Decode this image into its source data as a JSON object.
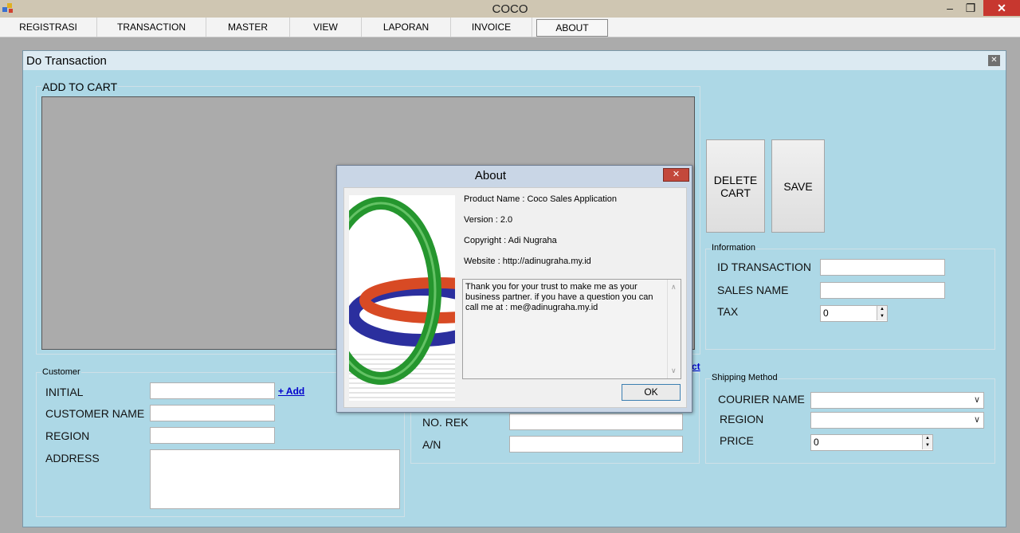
{
  "window": {
    "title": "COCO",
    "minimize": "–",
    "restore": "❐",
    "close": "✕"
  },
  "menu": [
    "REGISTRASI",
    "TRANSACTION",
    "MASTER",
    "VIEW",
    "LAPORAN",
    "INVOICE",
    "ABOUT"
  ],
  "child": {
    "title": "Do Transaction",
    "close": "✕"
  },
  "cart": {
    "group_label": "ADD TO CART",
    "delete_button": "DELETE CART",
    "save_button": "SAVE"
  },
  "information": {
    "group_label": "Information",
    "id_transaction_label": "ID TRANSACTION",
    "sales_name_label": "SALES NAME",
    "tax_label": "TAX",
    "tax_value": "0"
  },
  "customer": {
    "group_label": "Customer",
    "initial_label": "INITIAL",
    "add_link": "+ Add",
    "customer_name_label": "CUSTOMER NAME",
    "region_label": "REGION",
    "address_label": "ADDRESS"
  },
  "payment": {
    "partial_link": "ct",
    "no_rek_label": "NO. REK",
    "an_label": "A/N"
  },
  "shipping": {
    "group_label": "Shipping Method",
    "courier_label": "COURIER NAME",
    "region_label": "REGION",
    "price_label": "PRICE",
    "price_value": "0"
  },
  "about": {
    "title": "About",
    "close": "✕",
    "product_name": "Product Name : Coco Sales Application",
    "version": "Version : 2.0",
    "copyright": "Copyright : Adi Nugraha",
    "website": "Website : http://adinugraha.my.id",
    "description": "Thank you for your trust to make me as your business partner.  if you have a question you can call me at : me@adinugraha.my.id",
    "ok_button": "OK"
  },
  "colors": {
    "form_background": "#add8e6",
    "close_red": "#c7372f",
    "grid_gray": "#ababab"
  }
}
